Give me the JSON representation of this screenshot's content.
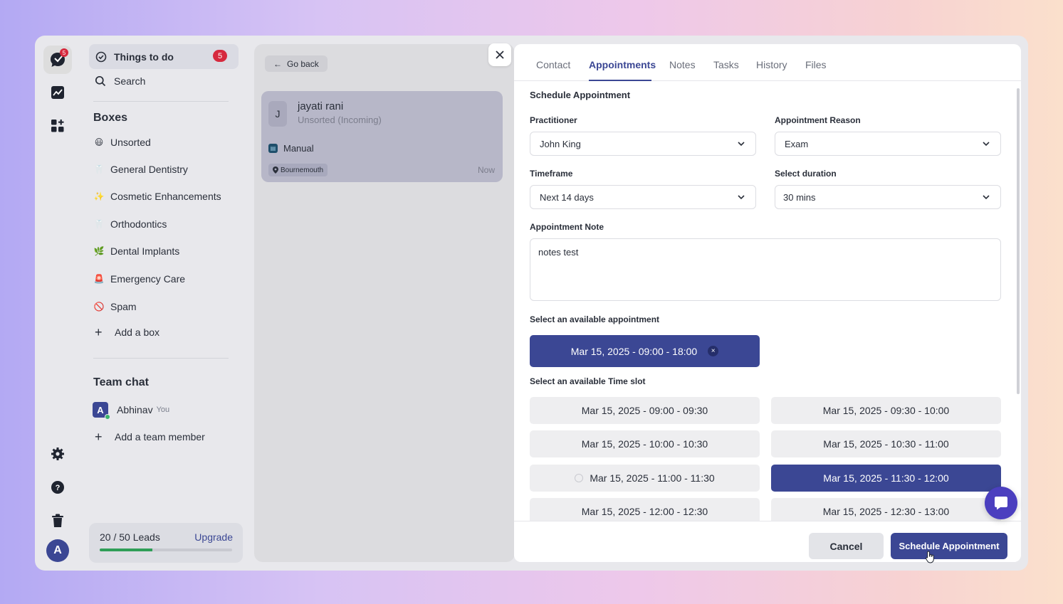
{
  "rail": {
    "logo_badge": "5",
    "user_initial": "A"
  },
  "sidebar": {
    "todo_label": "Things to do",
    "todo_count": "5",
    "search_label": "Search",
    "boxes_title": "Boxes",
    "boxes": [
      {
        "emoji": "😃",
        "label": "Unsorted"
      },
      {
        "emoji": "🦷",
        "label": "General Dentistry"
      },
      {
        "emoji": "✨",
        "label": "Cosmetic Enhancements"
      },
      {
        "emoji": "🦷",
        "label": "Orthodontics"
      },
      {
        "emoji": "🌿",
        "label": "Dental Implants"
      },
      {
        "emoji": "🚨",
        "label": "Emergency Care"
      },
      {
        "emoji": "🚫",
        "label": "Spam"
      }
    ],
    "add_box_label": "Add a box",
    "team_chat_title": "Team chat",
    "member": {
      "initial": "A",
      "name": "Abhinav",
      "tag": "You"
    },
    "add_member_label": "Add a team member",
    "leads": {
      "count_text": "20 / 50 Leads",
      "upgrade_label": "Upgrade",
      "used": 20,
      "limit": 50
    }
  },
  "middle": {
    "go_back_label": "Go back",
    "lead": {
      "initial": "J",
      "name": "jayati rani",
      "status": "Unsorted (Incoming)",
      "source": "Manual",
      "location": "Bournemouth",
      "time": "Now"
    }
  },
  "panel": {
    "tabs": [
      "Contact",
      "Appointments",
      "Notes",
      "Tasks",
      "History",
      "Files"
    ],
    "active_tab": "Appointments",
    "heading": "Schedule Appointment",
    "practitioner": {
      "label": "Practitioner",
      "value": "John King"
    },
    "reason": {
      "label": "Appointment Reason",
      "value": "Exam"
    },
    "timeframe": {
      "label": "Timeframe",
      "value": "Next 14 days"
    },
    "duration": {
      "label": "Select duration",
      "value": "30 mins"
    },
    "note": {
      "label": "Appointment Note",
      "value": "notes test"
    },
    "available_label": "Select an available appointment",
    "selected_appointment": "Mar 15, 2025 - 09:00 - 18:00",
    "timeslot_label": "Select an available Time slot",
    "slots": [
      "Mar 15, 2025 - 09:00 - 09:30",
      "Mar 15, 2025 - 09:30 - 10:00",
      "Mar 15, 2025 - 10:00 - 10:30",
      "Mar 15, 2025 - 10:30 - 11:00",
      "Mar 15, 2025 - 11:00 - 11:30",
      "Mar 15, 2025 - 11:30 - 12:00",
      "Mar 15, 2025 - 12:00 - 12:30",
      "Mar 15, 2025 - 12:30 - 13:00"
    ],
    "selected_slot": "Mar 15, 2025 - 11:30 - 12:00",
    "cancel_label": "Cancel",
    "schedule_label": "Schedule Appointment"
  },
  "colors": {
    "accent": "#3b4794",
    "badge": "#d6293e",
    "progress": "#2f9e57",
    "chat_fab": "#4b3fbf"
  }
}
